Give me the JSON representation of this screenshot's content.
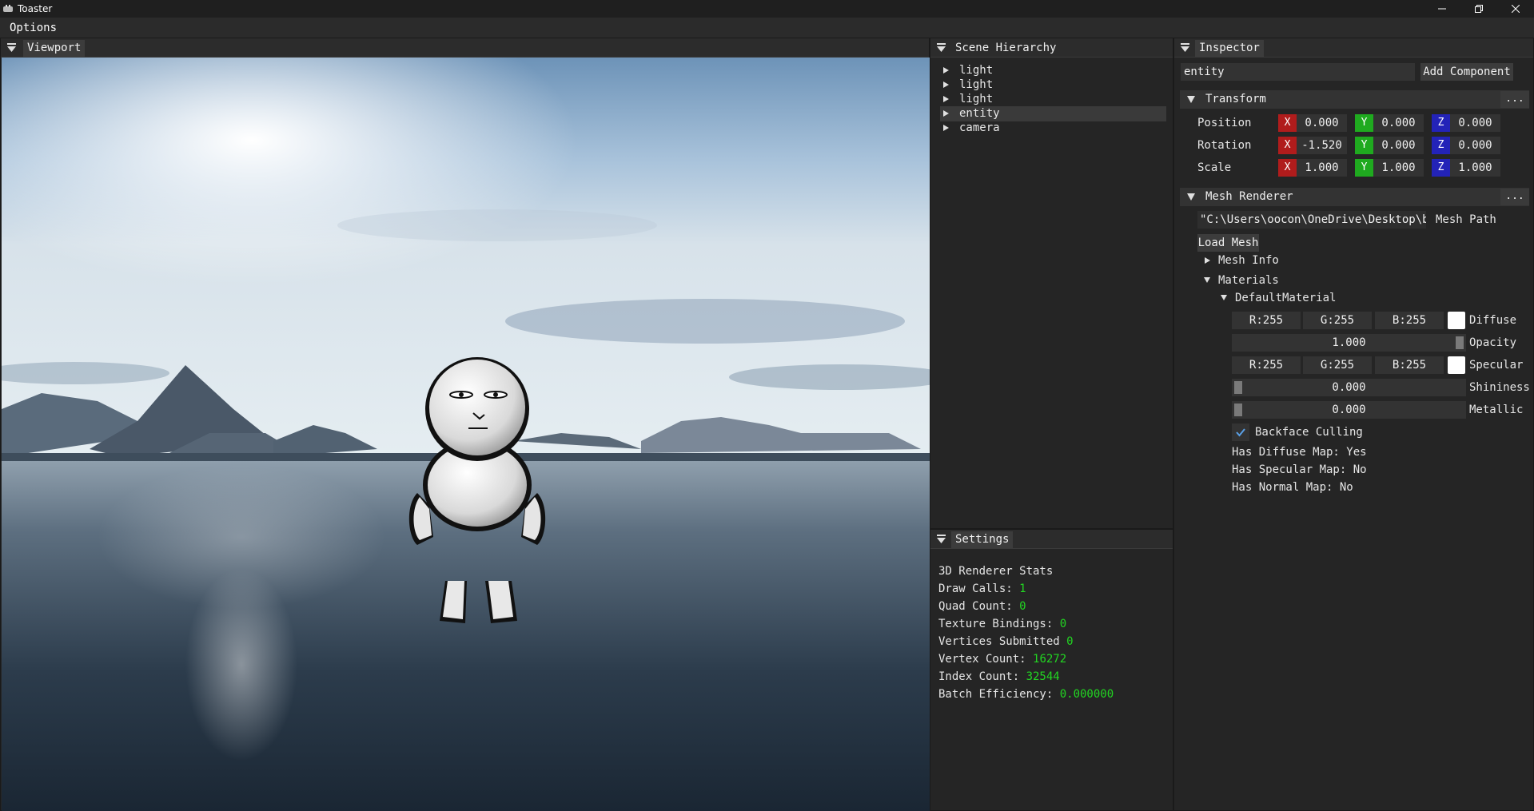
{
  "window": {
    "title": "Toaster",
    "minimize": "—",
    "restore": "❐",
    "close": "✕"
  },
  "menu": {
    "options": "Options"
  },
  "viewport": {
    "tab": "Viewport"
  },
  "hierarchy": {
    "tab": "Scene Hierarchy",
    "items": [
      {
        "label": "light"
      },
      {
        "label": "light"
      },
      {
        "label": "light"
      },
      {
        "label": "entity"
      },
      {
        "label": "camera"
      }
    ]
  },
  "settings": {
    "tab": "Settings",
    "heading": "3D Renderer Stats",
    "stats": [
      {
        "label": "Draw Calls: ",
        "value": "1"
      },
      {
        "label": "Quad Count: ",
        "value": "0"
      },
      {
        "label": "Texture Bindings: ",
        "value": "0"
      },
      {
        "label": "Vertices Submitted ",
        "value": "0"
      },
      {
        "label": "Vertex Count: ",
        "value": "16272"
      },
      {
        "label": "Index Count: ",
        "value": "32544"
      },
      {
        "label": "Batch Efficiency: ",
        "value": "0.000000"
      }
    ]
  },
  "inspector": {
    "tab": "Inspector",
    "entity_name": "entity",
    "add_component": "Add Component",
    "transform": {
      "title": "Transform",
      "more": "...",
      "axis": {
        "x": "X",
        "y": "Y",
        "z": "Z"
      },
      "position": {
        "label": "Position",
        "x": "0.000",
        "y": "0.000",
        "z": "0.000"
      },
      "rotation": {
        "label": "Rotation",
        "x": "-1.520",
        "y": "0.000",
        "z": "0.000"
      },
      "scale": {
        "label": "Scale",
        "x": "1.000",
        "y": "1.000",
        "z": "1.000"
      }
    },
    "mesh_renderer": {
      "title": "Mesh Renderer",
      "more": "...",
      "mesh_path_value": "\"C:\\Users\\oocon\\OneDrive\\Desktop\\blender\\",
      "mesh_path_label": "Mesh Path",
      "load_mesh": "Load Mesh",
      "mesh_info": "Mesh Info",
      "materials": "Materials",
      "material": {
        "name": "DefaultMaterial",
        "diffuse": {
          "r": "R:255",
          "g": "G:255",
          "b": "B:255",
          "label": "Diffuse"
        },
        "opacity": {
          "value": "1.000",
          "label": "Opacity"
        },
        "specular": {
          "r": "R:255",
          "g": "G:255",
          "b": "B:255",
          "label": "Specular"
        },
        "shininess": {
          "value": "0.000",
          "label": "Shininess"
        },
        "metallic": {
          "value": "0.000",
          "label": "Metallic"
        },
        "backface_culling": {
          "label": "Backface Culling",
          "checked": true
        },
        "has_diffuse_map": "Has Diffuse Map: Yes",
        "has_specular_map": "Has Specular Map: No",
        "has_normal_map": "Has Normal Map: No"
      }
    }
  }
}
